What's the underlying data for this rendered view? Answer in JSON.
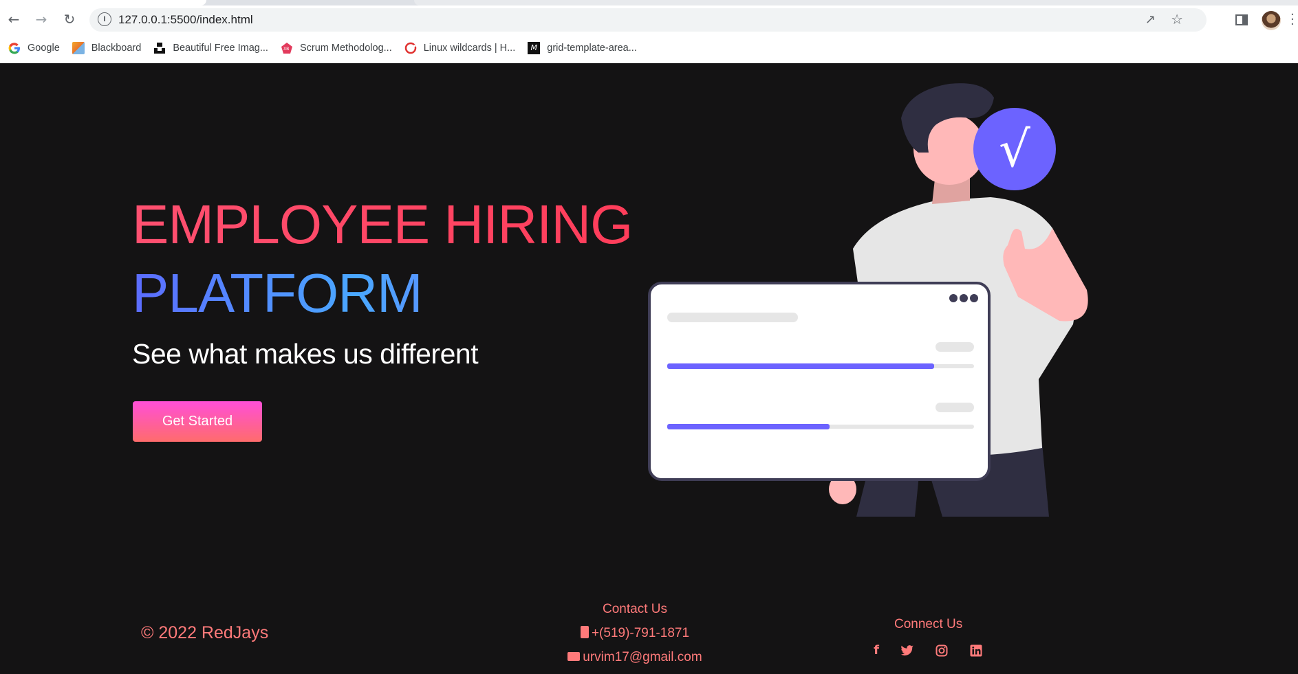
{
  "browser": {
    "url": "127.0.0.1:5500/index.html",
    "bookmarks": [
      {
        "label": "Google",
        "icon": "google-icon"
      },
      {
        "label": "Blackboard",
        "icon": "blackboard-icon"
      },
      {
        "label": "Beautiful Free Imag...",
        "icon": "unsplash-icon"
      },
      {
        "label": "Scrum Methodolog...",
        "icon": "xb-icon"
      },
      {
        "label": "Linux wildcards | H...",
        "icon": "linux-icon"
      },
      {
        "label": "grid-template-area...",
        "icon": "mdn-icon"
      }
    ]
  },
  "hero": {
    "title_line1": "EMPLOYEE HIRING",
    "title_line2": "PLATFORM",
    "subtitle": "See what makes us different",
    "cta_label": "Get Started"
  },
  "illustration": {
    "progress": [
      0.87,
      0.53
    ],
    "check_glyph": "√",
    "accent_color": "#6c63ff"
  },
  "footer": {
    "copyright": "© 2022 RedJays",
    "contact_title": "Contact Us",
    "phone": "+(519)-791-1871",
    "email": "urvim17@gmail.com",
    "connect_title": "Connect Us",
    "social": [
      "facebook-icon",
      "twitter-icon",
      "instagram-icon",
      "linkedin-icon"
    ]
  }
}
